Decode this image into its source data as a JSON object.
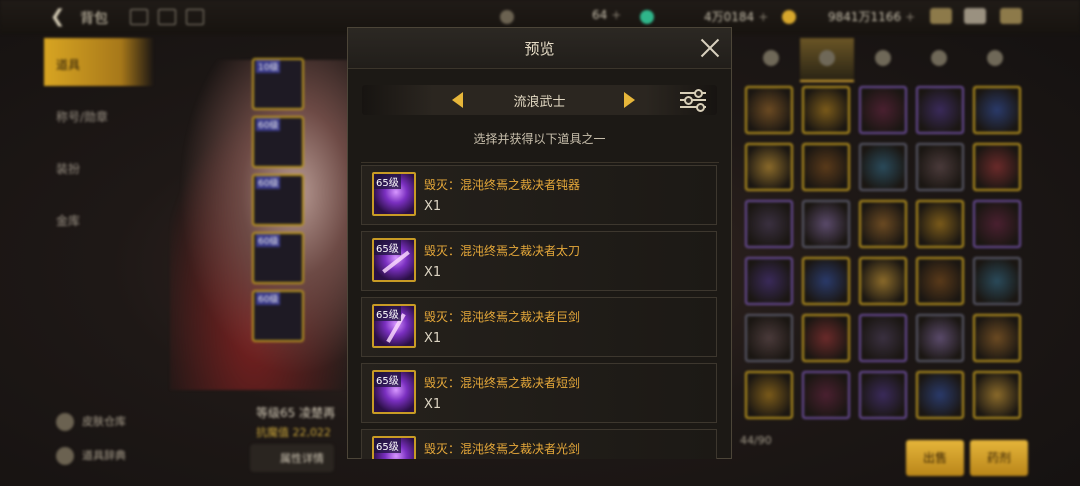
{
  "topbar": {
    "back_label": "❮",
    "title": "背包",
    "resources": [
      {
        "value": "64",
        "color": "#8a8273"
      },
      {
        "value": "4万0184",
        "color": "#2fb58a"
      },
      {
        "value": "9841万1166",
        "color": "#d7a72c"
      }
    ]
  },
  "leftnav": {
    "items": [
      "道具",
      "称号/勋章",
      "装扮",
      "金库"
    ],
    "footer": [
      "皮肤仓库",
      "道具辞典"
    ]
  },
  "character": {
    "name_line": "等级65 凌楚再",
    "power_line": "抗魔值 22,022",
    "attr_button": "属性详情",
    "equip_levels": [
      "10级",
      "60级",
      "60级",
      "60级",
      "60级"
    ]
  },
  "inventory": {
    "count": "44/90",
    "sell_button": "出售",
    "disassemble_button": "药剂"
  },
  "modal": {
    "title": "预览",
    "class_name": "流浪武士",
    "hint": "选择并获得以下道具之一",
    "items": [
      {
        "level": "65级",
        "name": "毁灭：混沌终焉之裁决者钝器",
        "qty": "X1"
      },
      {
        "level": "65级",
        "name": "毁灭：混沌终焉之裁决者太刀",
        "qty": "X1"
      },
      {
        "level": "65级",
        "name": "毁灭：混沌终焉之裁决者巨剑",
        "qty": "X1"
      },
      {
        "level": "65级",
        "name": "毁灭：混沌终焉之裁决者短剑",
        "qty": "X1"
      },
      {
        "level": "65级",
        "name": "毁灭：混沌终焉之裁决者光剑",
        "qty": "X1"
      }
    ]
  },
  "colors": {
    "accent_gold": "#e6b63a",
    "item_name": "#e7a93a",
    "panel_bg": "#1c1915"
  }
}
